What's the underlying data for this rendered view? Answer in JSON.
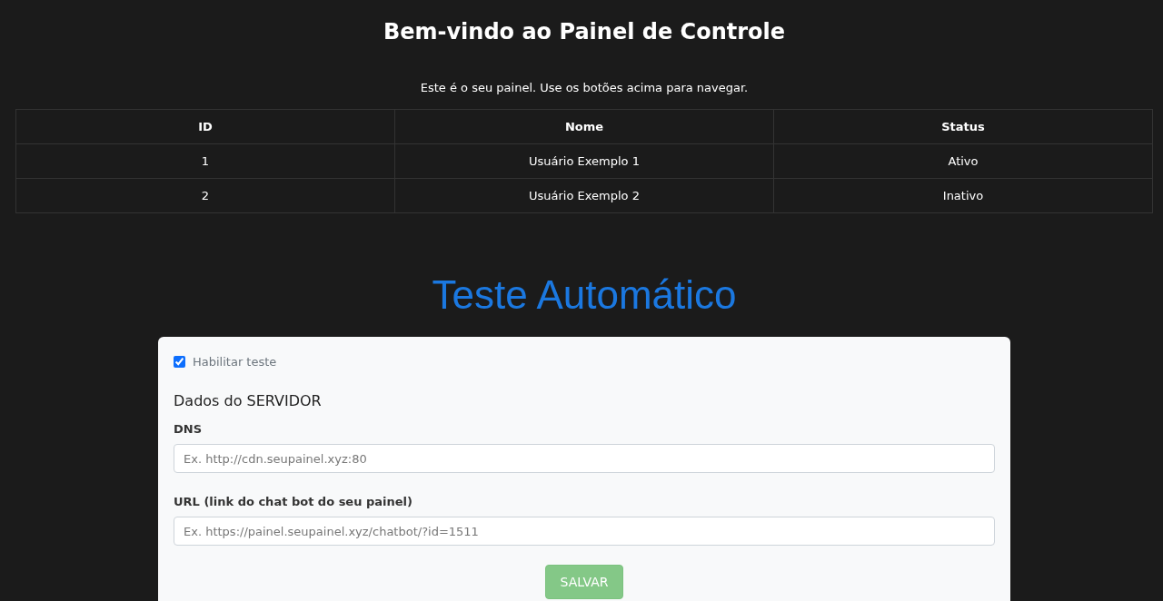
{
  "header": {
    "title": "Bem-vindo ao Painel de Controle",
    "subtitle": "Este é o seu painel. Use os botões acima para navegar."
  },
  "table": {
    "columns": [
      "ID",
      "Nome",
      "Status"
    ],
    "rows": [
      [
        "1",
        "Usuário Exemplo 1",
        "Ativo"
      ],
      [
        "2",
        "Usuário Exemplo 2",
        "Inativo"
      ]
    ]
  },
  "section_title": "Teste Automático",
  "form": {
    "enable": {
      "label": "Habilitar teste",
      "checked": true
    },
    "group_title": "Dados do SERVIDOR",
    "fields": [
      {
        "label": "DNS",
        "placeholder": "Ex. http://cdn.seupainel.xyz:80"
      },
      {
        "label": "URL (link do chat bot do seu painel)",
        "placeholder": "Ex. https://painel.seupainel.xyz/chatbot/?id=1511"
      }
    ],
    "submit": {
      "label": "SALVAR",
      "disabled": true
    }
  }
}
